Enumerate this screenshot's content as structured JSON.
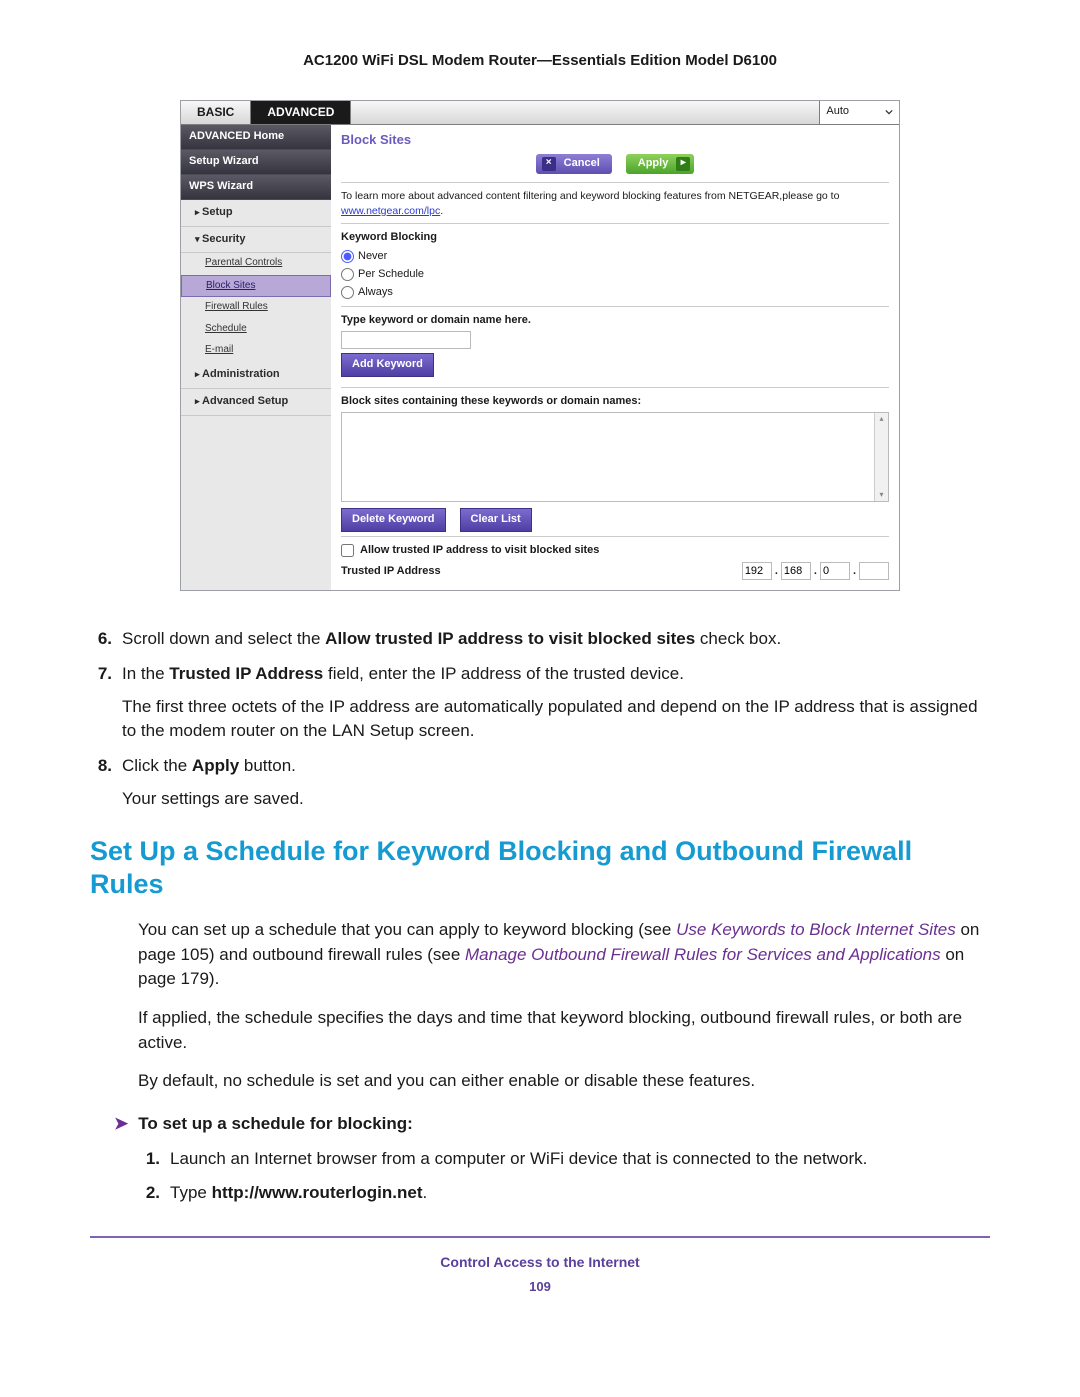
{
  "doc_title": "AC1200 WiFi DSL Modem Router—Essentials Edition Model D6100",
  "shot": {
    "tabs": {
      "basic": "BASIC",
      "advanced": "ADVANCED"
    },
    "lang": "Auto",
    "sidebar": {
      "home": "ADVANCED Home",
      "setup_wiz": "Setup Wizard",
      "wps_wiz": "WPS Wizard",
      "setup": "Setup",
      "security": "Security",
      "sec_items": {
        "parental": "Parental Controls",
        "block_sites": "Block Sites",
        "firewall": "Firewall Rules",
        "schedule": "Schedule",
        "email": "E-mail"
      },
      "admin": "Administration",
      "adv_setup": "Advanced Setup"
    },
    "panel": {
      "title": "Block Sites",
      "cancel": "Cancel",
      "apply": "Apply",
      "learn_more_pre": "To learn more about advanced content filtering and keyword blocking features from NETGEAR,please go to ",
      "learn_more_link": "www.netgear.com/lpc",
      "kb_head": "Keyword Blocking",
      "r_never": "Never",
      "r_sched": "Per Schedule",
      "r_always": "Always",
      "type_kw": "Type keyword or domain name here.",
      "add_kw": "Add Keyword",
      "block_head": "Block sites containing these keywords or domain names:",
      "del_kw": "Delete Keyword",
      "clear": "Clear List",
      "allow_ck": "Allow trusted IP address to visit blocked sites",
      "trusted": "Trusted IP Address",
      "ip": {
        "a": "192",
        "b": "168",
        "c": "0",
        "d": ""
      }
    }
  },
  "steps_a": {
    "s6": {
      "n": "6.",
      "pre": "Scroll down and select the ",
      "b": "Allow trusted IP address to visit blocked sites",
      "post": " check box."
    },
    "s7": {
      "n": "7.",
      "pre": "In the ",
      "b": "Trusted IP Address",
      "post": " field, enter the IP address of the trusted device.",
      "follow": "The first three octets of the IP address are automatically populated and depend on the IP address that is assigned to the modem router on the LAN Setup screen."
    },
    "s8": {
      "n": "8.",
      "pre": "Click the ",
      "b": "Apply",
      "post": " button.",
      "follow": "Your settings are saved."
    }
  },
  "h2": "Set Up a Schedule for Keyword Blocking and Outbound Firewall Rules",
  "para1": {
    "pre": "You can set up a schedule that you can apply to keyword blocking (see ",
    "l1": "Use Keywords to Block Internet Sites",
    "mid1": " on page 105) and outbound firewall rules (see ",
    "l2": "Manage Outbound Firewall Rules for Services and Applications",
    "mid2": " on page 179)."
  },
  "para2": "If applied, the schedule specifies the days and time that keyword blocking, outbound firewall rules, or both are active.",
  "para3": "By default, no schedule is set and you can either enable or disable these features.",
  "arrow_head": "To set up a schedule for blocking:",
  "steps_b": {
    "s1": {
      "n": "1.",
      "t": "Launch an Internet browser from a computer or WiFi device that is connected to the network."
    },
    "s2": {
      "n": "2.",
      "pre": "Type ",
      "b": "http://www.routerlogin.net",
      "post": "."
    }
  },
  "footer": {
    "caption": "Control Access to the Internet",
    "page": "109"
  }
}
